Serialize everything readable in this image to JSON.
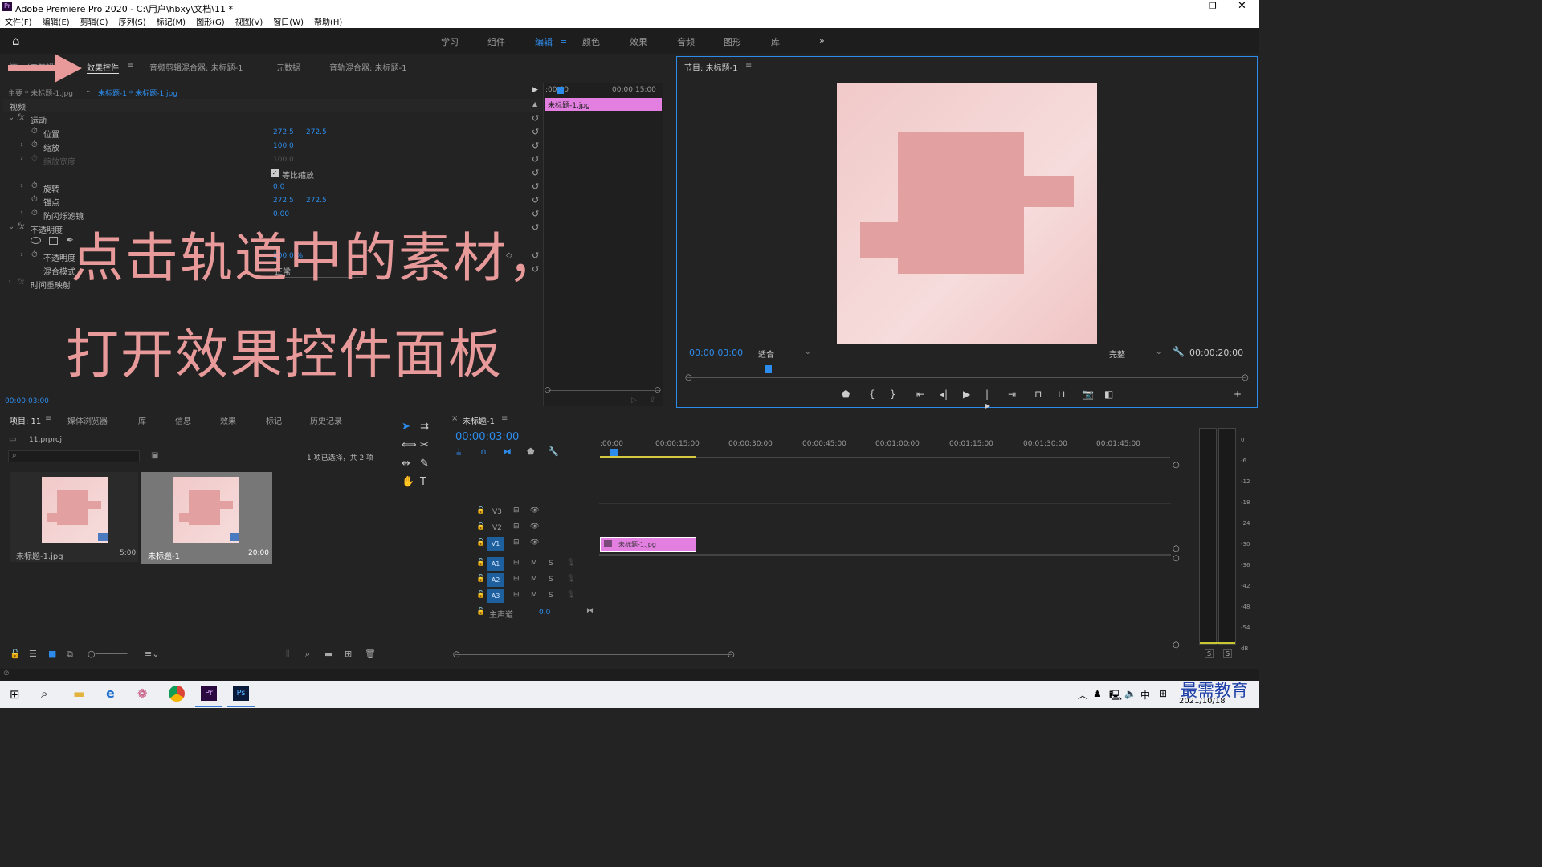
{
  "app": {
    "title": "Adobe Premiere Pro 2020 - C:\\用户\\hbxy\\文档\\11 *"
  },
  "menu": [
    "文件(F)",
    "编辑(E)",
    "剪辑(C)",
    "序列(S)",
    "标记(M)",
    "图形(G)",
    "视图(V)",
    "窗口(W)",
    "帮助(H)"
  ],
  "workspaces": [
    "学习",
    "组件",
    "编辑",
    "颜色",
    "效果",
    "音频",
    "图形",
    "库"
  ],
  "source_tabs": {
    "source": "源：（无剪辑）",
    "effect_controls": "效果控件",
    "audio_clip_mixer": "音频剪辑混合器: 未标题-1",
    "metadata": "元数据",
    "track_mixer": "音轨混合器: 未标题-1"
  },
  "effect_controls": {
    "master": "主要 * 未标题-1.jpg",
    "clip": "未标题-1 * 未标题-1.jpg",
    "video": "视频",
    "clip_bar": "未标题-1.jpg",
    "ruler_start": ":00:00",
    "ruler_end": "00:00:15:00",
    "motion": "运动",
    "position": "位置",
    "pos_x": "272.5",
    "pos_y": "272.5",
    "scale": "缩放",
    "scale_v": "100.0",
    "scale_width": "缩放宽度",
    "scale_width_v": "100.0",
    "uniform": "等比缩放",
    "rotation": "旋转",
    "rotation_v": "0.0",
    "anchor": "锚点",
    "anchor_x": "272.5",
    "anchor_y": "272.5",
    "flicker": "防闪烁滤镜",
    "flicker_v": "0.00",
    "opacity_group": "不透明度",
    "opacity": "不透明度",
    "opacity_v": "100.0 %",
    "blend": "混合模式",
    "blend_v": "正常",
    "time_remap": "时间重映射",
    "timecode": "00:00:03:00"
  },
  "overlay": {
    "line1": "点击轨道中的素材，",
    "line2": "打开效果控件面板"
  },
  "program": {
    "title": "节目: 未标题-1",
    "timecode": "00:00:03:00",
    "fit": "适合",
    "quality": "完整",
    "duration": "00:00:20:00"
  },
  "project": {
    "tabs": [
      "项目: 11",
      "媒体浏览器",
      "库",
      "信息",
      "效果",
      "标记",
      "历史记录"
    ],
    "file": "11.prproj",
    "selection": "1 项已选择，共 2 项",
    "items": [
      {
        "name": "未标题-1.jpg",
        "dur": "5:00"
      },
      {
        "name": "未标题-1",
        "dur": "20:00"
      }
    ]
  },
  "timeline": {
    "tab": "未标题-1",
    "timecode": "00:00:03:00",
    "ruler": [
      ":00:00",
      "00:00:15:00",
      "00:00:30:00",
      "00:00:45:00",
      "00:01:00:00",
      "00:01:15:00",
      "00:01:30:00",
      "00:01:45:00"
    ],
    "video_tracks": [
      "V3",
      "V2",
      "V1"
    ],
    "audio_tracks": [
      "A1",
      "A2",
      "A3"
    ],
    "master": "主声道",
    "master_v": "0.0",
    "clip": "未标题-1.jpg",
    "m": "M",
    "s": "S"
  },
  "meter": {
    "scale": [
      "0",
      "-6",
      "-12",
      "-18",
      "-24",
      "-30",
      "-36",
      "-42",
      "-48",
      "-54",
      "dB"
    ],
    "s": "S"
  },
  "tray": {
    "ime": "中",
    "date": "2021/10/18",
    "watermark": "最需教育"
  },
  "colors": {
    "accent": "#2d8ceb",
    "clip_pink": "#e27fe0",
    "arrow": "#e89a9a",
    "frame_bg": "#eebcbc",
    "shape": "#e2a0a0"
  }
}
